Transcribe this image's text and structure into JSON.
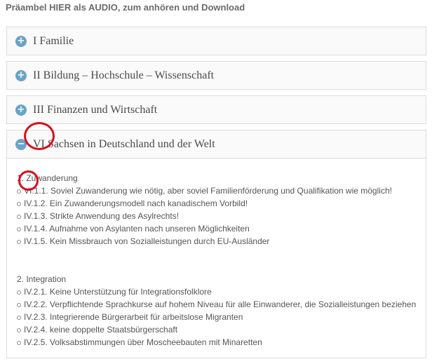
{
  "audio_link": "Präambel HIER als AUDIO, zum anhören und Download",
  "accordion": [
    {
      "title": "I Familie",
      "toggle": "+"
    },
    {
      "title": "II Bildung – Hochschule – Wissenschaft",
      "toggle": "+"
    },
    {
      "title": "III Finanzen und Wirtschaft",
      "toggle": "+"
    },
    {
      "title": "VI Sachsen in Deutschland und der Welt",
      "toggle": "−"
    }
  ],
  "open_panel": {
    "sections": [
      {
        "heading": "1. Zuwanderung",
        "items": [
          "VI.1.1. Soviel Zuwanderung wie nötig, aber soviel Familienförderung und Qualifikation wie möglich!",
          "IV.1.2. Ein Zuwanderungsmodell nach kanadischem Vorbild!",
          "IV.1.3. Strikte Anwendung des Asylrechts!",
          "IV.1.4. Aufnahme von Asylanten nach unseren Möglichkeiten",
          "IV.1.5. Kein Missbrauch von Sozialleistungen durch EU-Ausländer"
        ]
      },
      {
        "heading": "2. Integration",
        "items": [
          "IV.2.1. Keine Unterstützung für Integrationsfolklore",
          "IV.2.2. Verpflichtende Sprachkurse auf hohem Niveau für alle Einwanderer, die Sozialleistungen beziehen",
          "IV.2.3. Integrierende Bürgerarbeit für arbeitslose Migranten",
          "IV.2.4. keine doppelte Staatsbürgerschaft",
          "IV.2.5. Volksabstimmungen über Moscheebauten mit Minaretten"
        ]
      }
    ]
  },
  "colors": {
    "toggle": "#6aa3c9",
    "annotation": "#d6101e"
  }
}
